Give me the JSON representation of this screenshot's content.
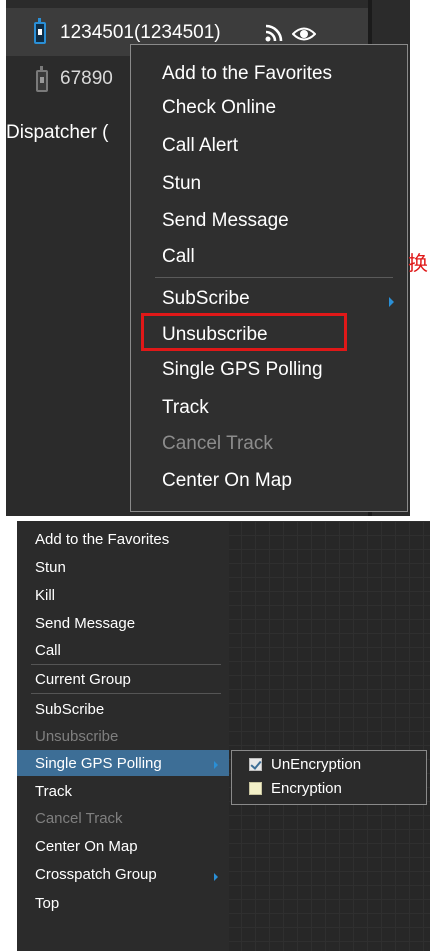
{
  "panel1": {
    "rows": [
      {
        "name": "1234501(1234501)"
      },
      {
        "name": "67890"
      },
      {
        "name": "Dispatcher ("
      }
    ],
    "menu": [
      {
        "label": "Add to the Favorites",
        "enabled": true
      },
      {
        "label": "Check Online",
        "enabled": true
      },
      {
        "label": "Call Alert",
        "enabled": true
      },
      {
        "label": "Stun",
        "enabled": true
      },
      {
        "label": "Send Message",
        "enabled": true
      },
      {
        "label": "Call",
        "enabled": true
      },
      {
        "label": "SubScribe",
        "enabled": true,
        "has_submenu": true
      },
      {
        "label": "Unsubscribe",
        "enabled": true
      },
      {
        "label": "Single GPS Polling",
        "enabled": true,
        "highlighted": true
      },
      {
        "label": "Track",
        "enabled": true
      },
      {
        "label": "Cancel Track",
        "enabled": false
      },
      {
        "label": "Center On Map",
        "enabled": true
      }
    ],
    "side_text": "换"
  },
  "panel2": {
    "menu": [
      {
        "label": "Add to the Favorites",
        "enabled": true
      },
      {
        "label": "Stun",
        "enabled": true
      },
      {
        "label": "Kill",
        "enabled": true
      },
      {
        "label": "Send Message",
        "enabled": true
      },
      {
        "label": "Call",
        "enabled": true
      },
      {
        "label": "Current Group",
        "enabled": true
      },
      {
        "label": "SubScribe",
        "enabled": true
      },
      {
        "label": "Unsubscribe",
        "enabled": false
      },
      {
        "label": "Single GPS Polling",
        "enabled": true,
        "active": true,
        "has_submenu": true
      },
      {
        "label": "Track",
        "enabled": true
      },
      {
        "label": "Cancel Track",
        "enabled": false
      },
      {
        "label": "Center On Map",
        "enabled": true
      },
      {
        "label": "Crosspatch Group",
        "enabled": true,
        "has_submenu": true
      },
      {
        "label": "Top",
        "enabled": true
      }
    ],
    "submenu": [
      {
        "label": "UnEncryption",
        "checked": true
      },
      {
        "label": "Encryption",
        "checked": false
      }
    ]
  },
  "colors": {
    "highlight_border": "#e01818",
    "accent_blue": "#2a8fd6",
    "active_item": "#3d6e96"
  }
}
